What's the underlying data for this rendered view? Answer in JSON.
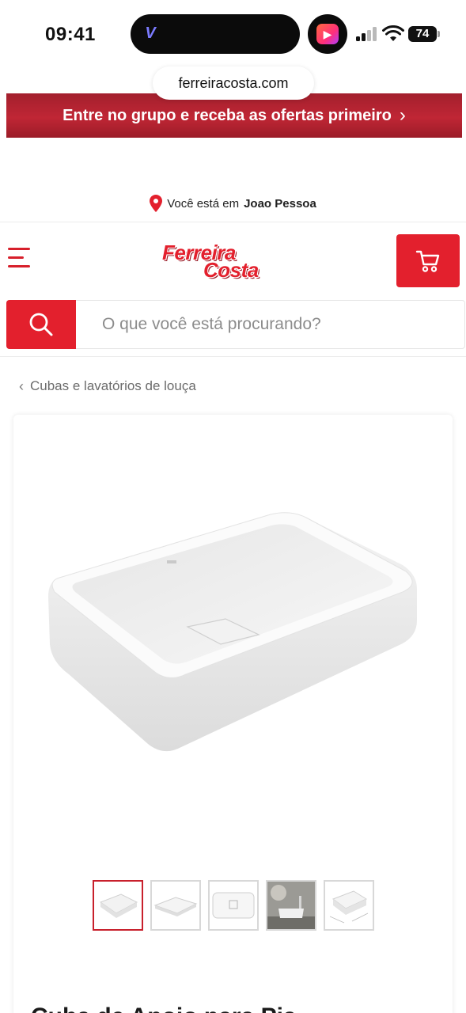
{
  "status_bar": {
    "time": "09:41",
    "island_app": "V",
    "app_pill_icon": "media-app-icon",
    "battery": "74"
  },
  "browser": {
    "url": "ferreiracosta.com"
  },
  "promo_banner": {
    "text": "Entre no grupo e receba as ofertas primeiro",
    "chevron": "›",
    "color": "#b5222f"
  },
  "location": {
    "prefix": "Você está em",
    "city": "Joao Pessoa",
    "icon": "map-pin-icon"
  },
  "header": {
    "menu_icon": "hamburger-menu-icon",
    "logo_line1": "Ferreira",
    "logo_line2": "Costa",
    "cart_icon": "cart-icon",
    "brand_color": "#e3202d"
  },
  "search": {
    "placeholder": "O que você está procurando?",
    "value": "",
    "icon": "search-icon"
  },
  "breadcrumb": {
    "chevron": "‹",
    "label": "Cubas e lavatórios de louça"
  },
  "product": {
    "image_alt": "white rectangular countertop washbasin",
    "thumbnails": [
      {
        "name": "thumb-1",
        "active": true
      },
      {
        "name": "thumb-2",
        "active": false
      },
      {
        "name": "thumb-3",
        "active": false
      },
      {
        "name": "thumb-4",
        "active": false
      },
      {
        "name": "thumb-5",
        "active": false
      }
    ],
    "title_partial": "Cuba de Apoio para Pia"
  }
}
